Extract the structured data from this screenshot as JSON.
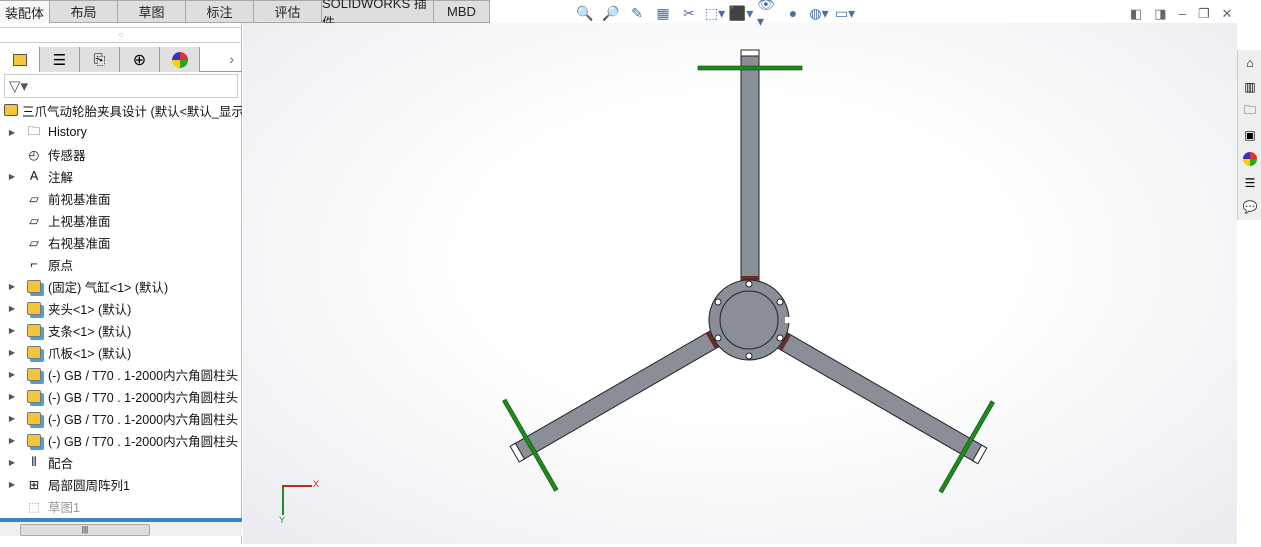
{
  "tabs": [
    "装配体",
    "布局",
    "草图",
    "标注",
    "评估",
    "SOLIDWORKS 插件",
    "MBD"
  ],
  "tree": {
    "root": "三爪气动轮胎夹具设计  (默认<默认_显示",
    "items": [
      {
        "label": "History",
        "icon": "history-folder-icon",
        "expand": true
      },
      {
        "label": "传感器",
        "icon": "sensor-icon",
        "expand": false
      },
      {
        "label": "注解",
        "icon": "annotation-icon",
        "expand": true
      },
      {
        "label": "前视基准面",
        "icon": "plane-icon",
        "expand": false
      },
      {
        "label": "上视基准面",
        "icon": "plane-icon",
        "expand": false
      },
      {
        "label": "右视基准面",
        "icon": "plane-icon",
        "expand": false
      },
      {
        "label": "原点",
        "icon": "origin-icon",
        "expand": false
      },
      {
        "label": "(固定) 气缸<1> (默认)",
        "icon": "part-icon",
        "expand": true
      },
      {
        "label": "夹头<1> (默认)",
        "icon": "part-icon",
        "expand": true
      },
      {
        "label": "支条<1> (默认)",
        "icon": "part-icon",
        "expand": true
      },
      {
        "label": "爪板<1> (默认)",
        "icon": "part-icon",
        "expand": true
      },
      {
        "label": "(-) GB / T70 . 1-2000内六角圆柱头",
        "icon": "part-icon",
        "expand": true
      },
      {
        "label": "(-) GB / T70 . 1-2000内六角圆柱头",
        "icon": "part-icon",
        "expand": true
      },
      {
        "label": "(-) GB / T70 . 1-2000内六角圆柱头",
        "icon": "part-icon",
        "expand": true
      },
      {
        "label": "(-) GB / T70 . 1-2000内六角圆柱头",
        "icon": "part-icon",
        "expand": true
      },
      {
        "label": "配合",
        "icon": "mates-icon",
        "expand": true
      },
      {
        "label": "局部圆周阵列1",
        "icon": "pattern-icon",
        "expand": true
      },
      {
        "label": "草图1",
        "icon": "sketch-icon",
        "expand": false
      }
    ]
  },
  "triad": {
    "x": "X",
    "y": "Y"
  },
  "colors": {
    "part": "#8a8e96",
    "accent": "#3a87c8",
    "green": "#1e8a1e"
  }
}
